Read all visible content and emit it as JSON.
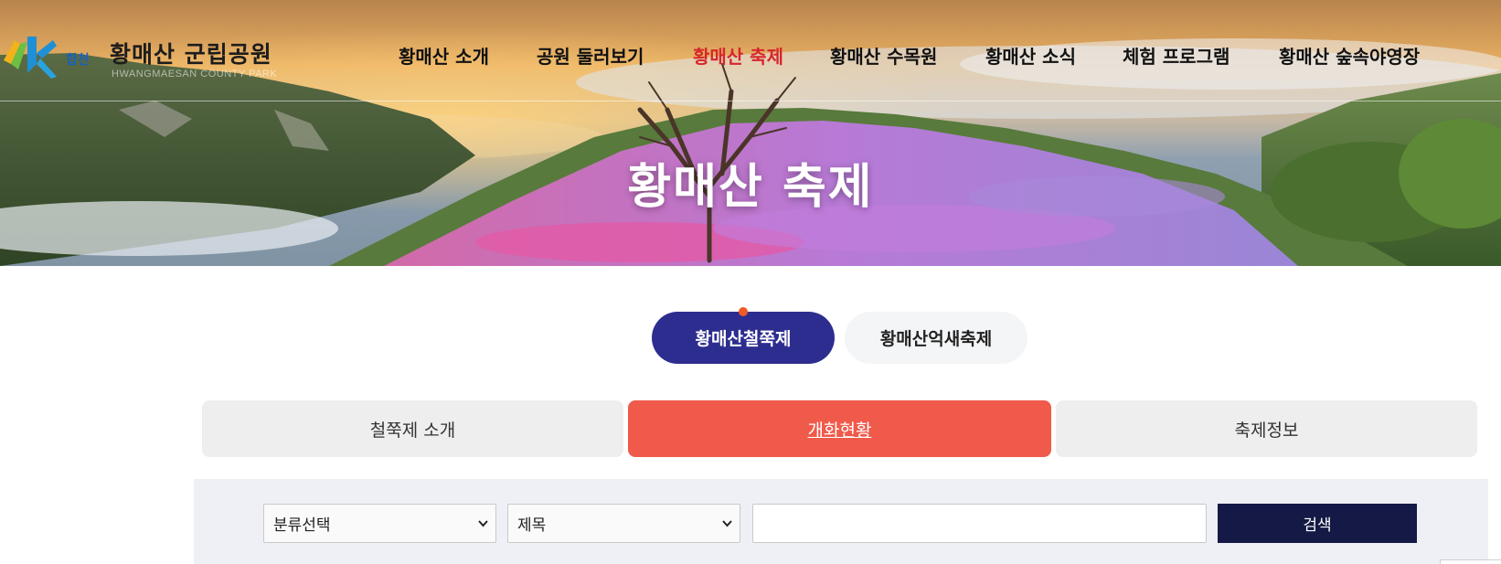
{
  "header": {
    "logo": {
      "title": "황매산 군립공원",
      "subtitle": "HWANGMAESAN COUNTY PARK",
      "mark_text": "합천"
    },
    "nav": [
      {
        "label": "황매산 소개",
        "active": false
      },
      {
        "label": "공원 둘러보기",
        "active": false
      },
      {
        "label": "황매산 축제",
        "active": true
      },
      {
        "label": "황매산 수목원",
        "active": false
      },
      {
        "label": "황매산 소식",
        "active": false
      },
      {
        "label": "체험 프로그램",
        "active": false
      },
      {
        "label": "황매산 숲속야영장",
        "active": false
      }
    ]
  },
  "hero": {
    "title": "황매산 축제"
  },
  "festival_tabs": [
    {
      "label": "황매산철쭉제",
      "active": true
    },
    {
      "label": "황매산억새축제",
      "active": false
    }
  ],
  "sub_tabs": [
    {
      "label": "철쭉제 소개",
      "active": false
    },
    {
      "label": "개화현황",
      "active": true
    },
    {
      "label": "축제정보",
      "active": false
    }
  ],
  "search": {
    "category_select": {
      "selected": "분류선택"
    },
    "field_select": {
      "selected": "제목"
    },
    "keyword_input": {
      "value": "",
      "placeholder": ""
    },
    "button_label": "검색"
  },
  "colors": {
    "nav_active": "#d7262b",
    "pill_active": "#2d2d8f",
    "subtab_active": "#f05a4b",
    "search_button": "#141a45",
    "dot": "#f05a28"
  }
}
